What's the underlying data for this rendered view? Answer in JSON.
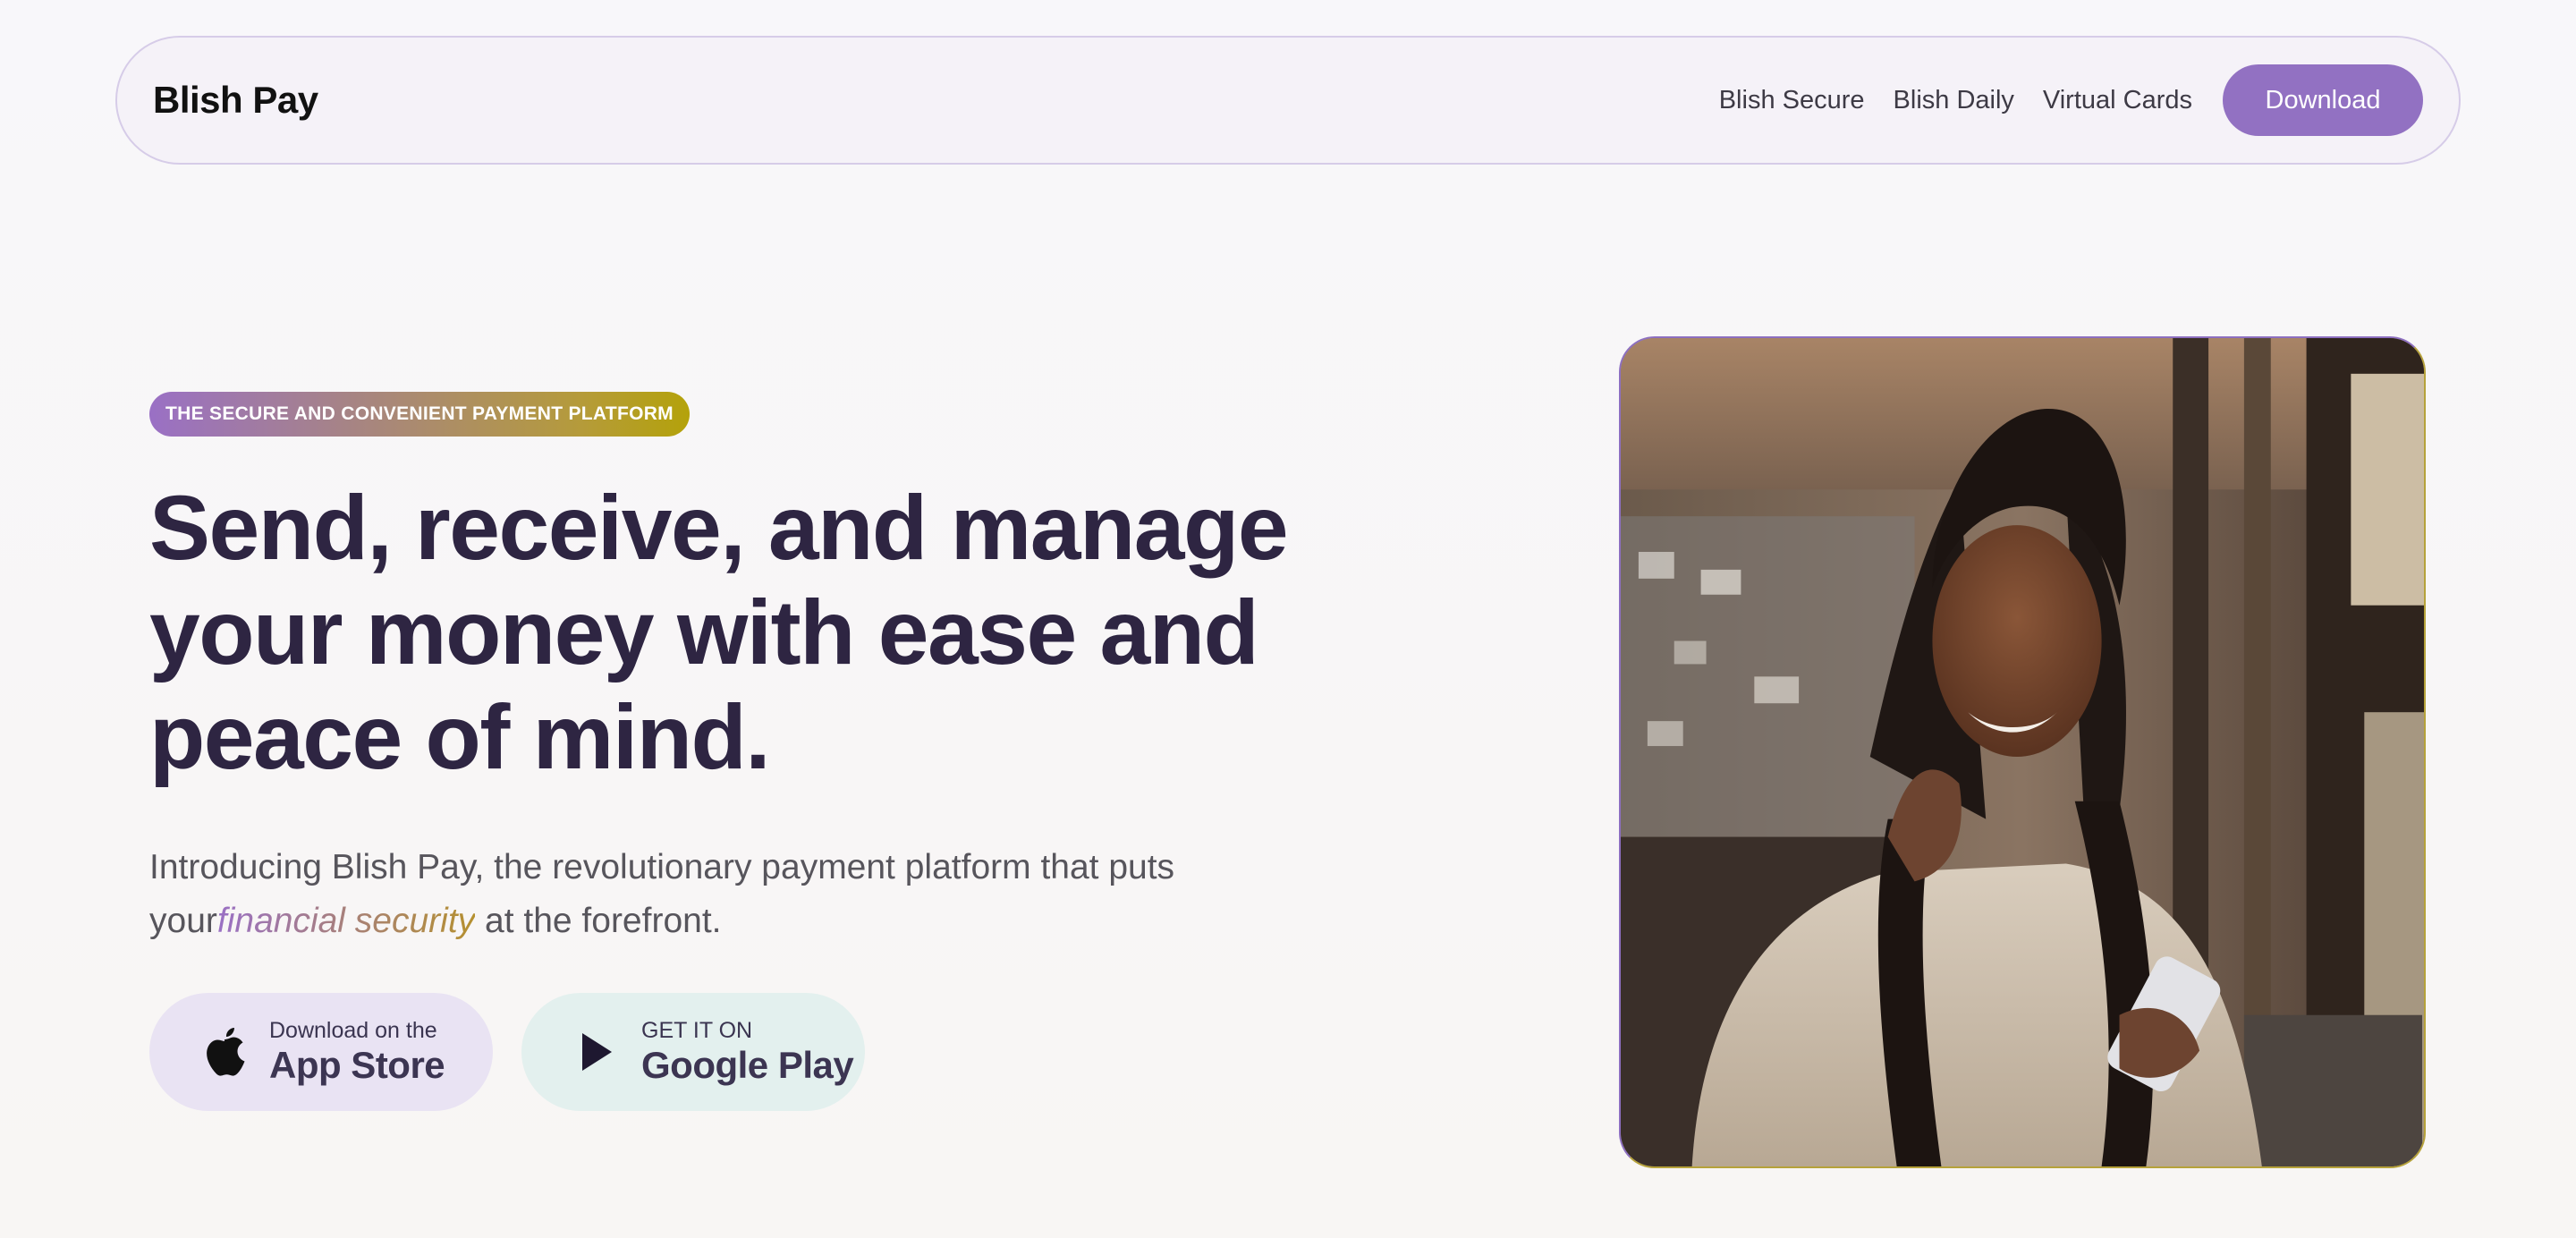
{
  "navbar": {
    "brand": "Blish Pay",
    "links": [
      "Blish Secure",
      "Blish Daily",
      "Virtual Cards"
    ],
    "cta_label": "Download"
  },
  "hero": {
    "eyebrow": "THE SECURE AND CONVENIENT PAYMENT PLATFORM",
    "headline_lines": [
      "Send, receive, and manage",
      "your money with ease and",
      "peace of mind."
    ],
    "intro_before": "Introducing Blish Pay, the revolutionary payment platform that puts your",
    "intro_accent": "financial security",
    "intro_after": " at the forefront.",
    "app_store": {
      "small": "Download on the",
      "big": "App Store",
      "icon": "apple-icon"
    },
    "google_play": {
      "small": "GET IT ON",
      "big": "Google Play",
      "icon": "play-icon"
    },
    "photo_alt": "Woman smiling at phone"
  },
  "colors": {
    "accent_purple": "#9271c2",
    "accent_gold": "#b4a20a",
    "heading": "#2e2542"
  }
}
